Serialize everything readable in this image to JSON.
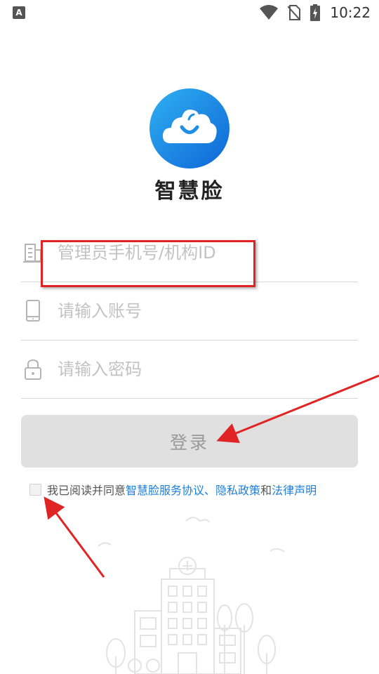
{
  "status_bar": {
    "time": "10:22",
    "left_badge": "A"
  },
  "brand": {
    "name": "智慧脸"
  },
  "form": {
    "org_placeholder": "管理员手机号/机构ID",
    "account_placeholder": "请输入账号",
    "password_placeholder": "请输入密码",
    "login_label": "登录"
  },
  "agreement": {
    "prefix": "我已阅读并同意",
    "service_link": "智慧脸服务协议",
    "sep": "、",
    "privacy_link": "隐私政策",
    "and": "和",
    "legal_link": "法律声明"
  },
  "colors": {
    "link": "#1a7fd9",
    "logo_blue": "#1e8fe6",
    "annotation_red": "#e02424"
  },
  "icons": [
    "building-icon",
    "phone-icon",
    "lock-icon",
    "wifi-icon",
    "no-sim-icon",
    "battery-icon"
  ]
}
